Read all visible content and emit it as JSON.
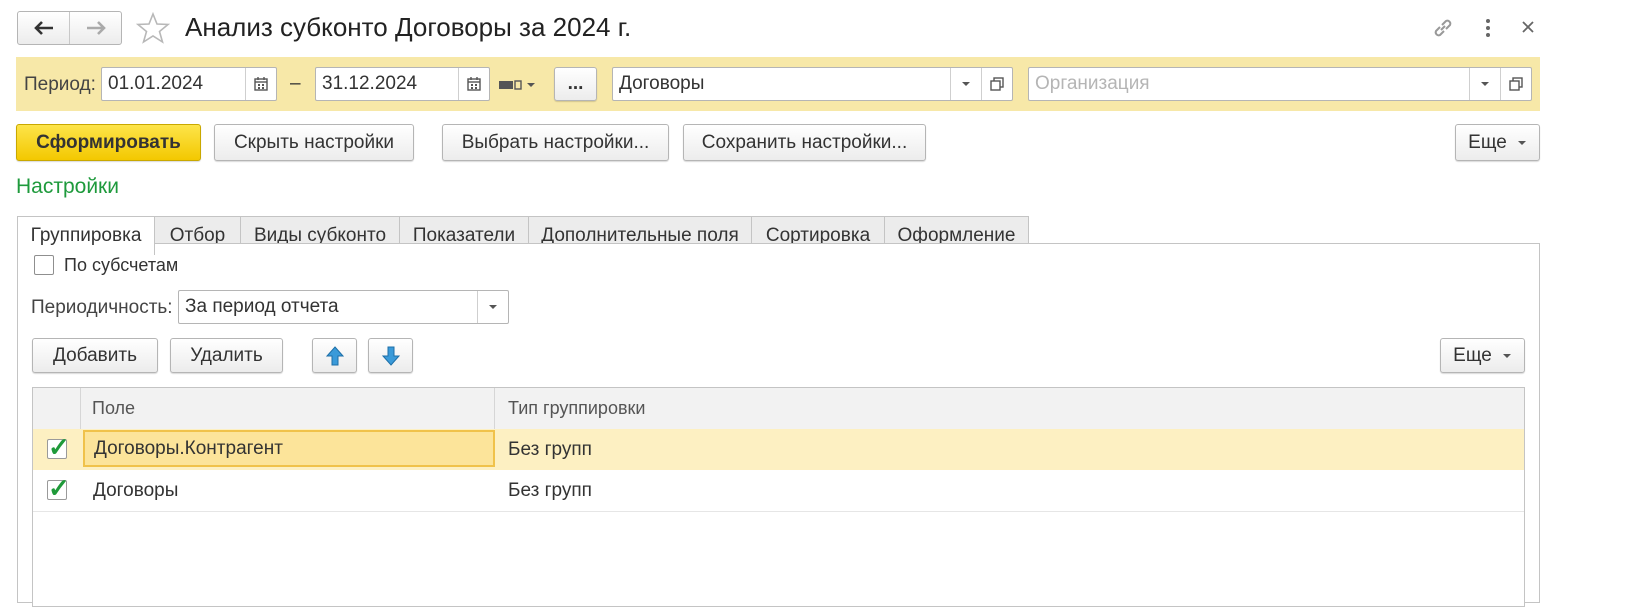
{
  "window": {
    "title": "Анализ субконто Договоры за 2024 г."
  },
  "filter_bar": {
    "period_label": "Период:",
    "date_from": "01.01.2024",
    "dash": "–",
    "date_to": "31.12.2024",
    "ellipsis_label": "...",
    "subconto_value": "Договоры",
    "organization_placeholder": "Организация"
  },
  "toolbar": {
    "generate_label": "Сформировать",
    "hide_settings_label": "Скрыть настройки",
    "choose_settings_label": "Выбрать настройки...",
    "save_settings_label": "Сохранить настройки...",
    "more_label": "Еще"
  },
  "settings": {
    "heading": "Настройки",
    "tabs": [
      {
        "label": "Группировка"
      },
      {
        "label": "Отбор"
      },
      {
        "label": "Виды субконто"
      },
      {
        "label": "Показатели"
      },
      {
        "label": "Дополнительные поля"
      },
      {
        "label": "Сортировка"
      },
      {
        "label": "Оформление"
      }
    ],
    "by_subaccounts_label": "По субсчетам",
    "periodicity_label": "Периодичность:",
    "periodicity_value": "За период отчета",
    "add_label": "Добавить",
    "delete_label": "Удалить",
    "more_label": "Еще"
  },
  "table": {
    "columns": [
      "Поле",
      "Тип группировки"
    ],
    "rows": [
      {
        "field": "Договоры.Контрагент",
        "type": "Без групп",
        "checked": true,
        "selected": true
      },
      {
        "field": "Договоры",
        "type": "Без групп",
        "checked": true,
        "selected": false
      }
    ]
  },
  "colors": {
    "accent_yellow": "#f7e8a8",
    "primary_button": "#f5d21a",
    "settings_heading": "#1e9a3c",
    "selected_row": "#fdf0c2",
    "checkmark": "#1f9a3a"
  }
}
